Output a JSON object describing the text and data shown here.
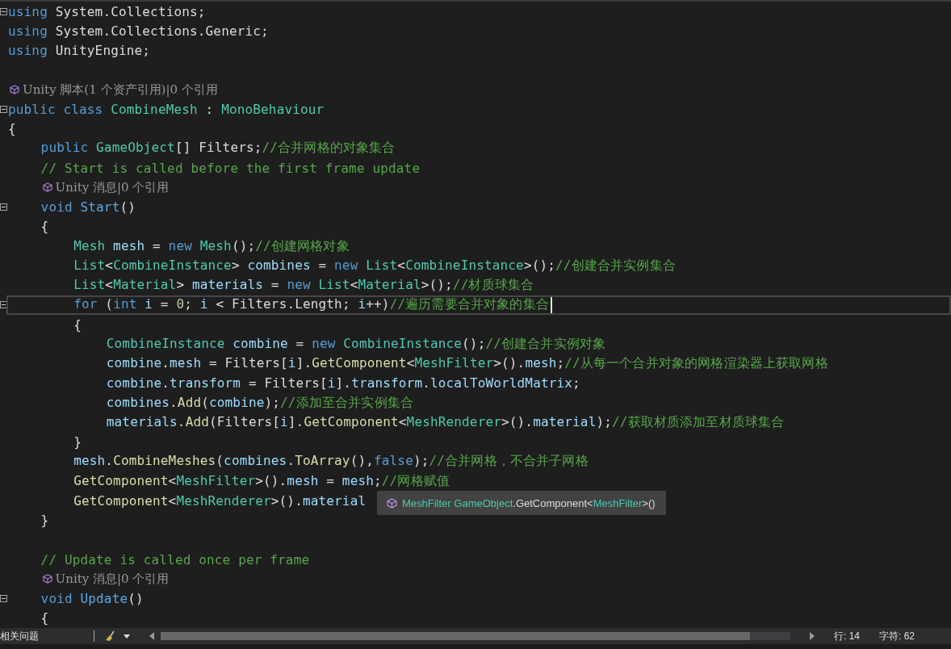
{
  "lines": [
    {
      "kind": "code",
      "fold": true,
      "current": false,
      "tokens": [
        {
          "t": "using",
          "color": "#569cd6"
        },
        {
          "t": " System.Collections;",
          "color": "#dcdcdc"
        }
      ]
    },
    {
      "kind": "code",
      "fold": false,
      "current": false,
      "tokens": [
        {
          "t": "using",
          "color": "#569cd6"
        },
        {
          "t": " System.Collections.Generic;",
          "color": "#dcdcdc"
        }
      ]
    },
    {
      "kind": "code",
      "fold": false,
      "current": false,
      "tokens": [
        {
          "t": "using",
          "color": "#569cd6"
        },
        {
          "t": " UnityEngine;",
          "color": "#dcdcdc"
        }
      ]
    },
    {
      "kind": "blank"
    },
    {
      "kind": "lens",
      "text": "Unity 脚本(1 个资产引用)|0 个引用"
    },
    {
      "kind": "code",
      "fold": true,
      "current": false,
      "tokens": [
        {
          "t": "public",
          "color": "#569cd6"
        },
        {
          "t": " class",
          "color": "#569cd6"
        },
        {
          "t": " CombineMesh",
          "color": "#4ec9b0"
        },
        {
          "t": " : ",
          "color": "#dcdcdc"
        },
        {
          "t": "MonoBehaviour",
          "color": "#4ec9b0"
        }
      ]
    },
    {
      "kind": "code",
      "fold": false,
      "current": false,
      "tokens": [
        {
          "t": "{",
          "color": "#dcdcdc"
        }
      ],
      "children": [
        {
          "kind": "code",
          "fold": false,
          "current": false,
          "tokens": [
            {
              "t": "public",
              "color": "#569cd6"
            },
            {
              "t": " GameObject",
              "color": "#4ec9b0"
            },
            {
              "t": "[] Filters;",
              "color": "#dcdcdc"
            },
            {
              "t": "//合并网格的对象集合",
              "color": "#57a64a"
            }
          ]
        },
        {
          "kind": "code",
          "fold": false,
          "current": false,
          "tokens": [
            {
              "t": "// Start is called before the first frame update",
              "color": "#57a64a"
            }
          ]
        },
        {
          "kind": "lens",
          "text": "Unity 消息|0 个引用"
        },
        {
          "kind": "code",
          "fold": true,
          "current": false,
          "tokens": [
            {
              "t": "void",
              "color": "#569cd6"
            },
            {
              "t": " Start",
              "color": "#5ca8e6"
            },
            {
              "t": "()",
              "color": "#dcdcdc"
            }
          ]
        },
        {
          "kind": "code",
          "fold": false,
          "current": false,
          "tokens": [
            {
              "t": "{",
              "color": "#dcdcdc"
            }
          ],
          "children": [
            {
              "kind": "code",
              "fold": false,
              "current": false,
              "tokens": [
                {
                  "t": "Mesh",
                  "color": "#4ec9b0"
                },
                {
                  "t": " mesh",
                  "color": "#9cdcfe"
                },
                {
                  "t": " = ",
                  "color": "#dcdcdc"
                },
                {
                  "t": "new",
                  "color": "#569cd6"
                },
                {
                  "t": " Mesh",
                  "color": "#4ec9b0"
                },
                {
                  "t": "();",
                  "color": "#dcdcdc"
                },
                {
                  "t": "//创建网格对象",
                  "color": "#57a64a"
                }
              ]
            },
            {
              "kind": "code",
              "fold": false,
              "current": false,
              "tokens": [
                {
                  "t": "List",
                  "color": "#4ec9b0"
                },
                {
                  "t": "<",
                  "color": "#dcdcdc"
                },
                {
                  "t": "CombineInstance",
                  "color": "#4ec9b0"
                },
                {
                  "t": ">",
                  "color": "#dcdcdc"
                },
                {
                  "t": " combines",
                  "color": "#9cdcfe"
                },
                {
                  "t": " = ",
                  "color": "#dcdcdc"
                },
                {
                  "t": "new",
                  "color": "#569cd6"
                },
                {
                  "t": " List",
                  "color": "#4ec9b0"
                },
                {
                  "t": "<",
                  "color": "#dcdcdc"
                },
                {
                  "t": "CombineInstance",
                  "color": "#4ec9b0"
                },
                {
                  "t": ">();",
                  "color": "#dcdcdc"
                },
                {
                  "t": "//创建合并实例集合",
                  "color": "#57a64a"
                }
              ]
            },
            {
              "kind": "code",
              "fold": false,
              "current": false,
              "tokens": [
                {
                  "t": "List",
                  "color": "#4ec9b0"
                },
                {
                  "t": "<",
                  "color": "#dcdcdc"
                },
                {
                  "t": "Material",
                  "color": "#4ec9b0"
                },
                {
                  "t": ">",
                  "color": "#dcdcdc"
                },
                {
                  "t": " materials",
                  "color": "#9cdcfe"
                },
                {
                  "t": " = ",
                  "color": "#dcdcdc"
                },
                {
                  "t": "new",
                  "color": "#569cd6"
                },
                {
                  "t": " List",
                  "color": "#4ec9b0"
                },
                {
                  "t": "<",
                  "color": "#dcdcdc"
                },
                {
                  "t": "Material",
                  "color": "#4ec9b0"
                },
                {
                  "t": ">();",
                  "color": "#dcdcdc"
                },
                {
                  "t": "//材质球集合",
                  "color": "#57a64a"
                }
              ]
            },
            {
              "kind": "code",
              "fold": true,
              "current": true,
              "tokens": [
                {
                  "t": "for",
                  "color": "#569cd6"
                },
                {
                  "t": " (",
                  "color": "#dcdcdc"
                },
                {
                  "t": "int",
                  "color": "#569cd6"
                },
                {
                  "t": " i",
                  "color": "#9cdcfe"
                },
                {
                  "t": " = ",
                  "color": "#dcdcdc"
                },
                {
                  "t": "0",
                  "color": "#b5cea8"
                },
                {
                  "t": "; ",
                  "color": "#dcdcdc"
                },
                {
                  "t": "i",
                  "color": "#9cdcfe"
                },
                {
                  "t": " < Filters.Length; ",
                  "color": "#dcdcdc"
                },
                {
                  "t": "i",
                  "color": "#9cdcfe"
                },
                {
                  "t": "++)",
                  "color": "#dcdcdc"
                },
                {
                  "t": "//遍历需要合并对象的集合",
                  "color": "#57a64a"
                }
              ]
            },
            {
              "kind": "code",
              "fold": false,
              "current": false,
              "tokens": [
                {
                  "t": "{",
                  "color": "#dcdcdc"
                }
              ],
              "children": [
                {
                  "kind": "code",
                  "fold": false,
                  "current": false,
                  "tokens": [
                    {
                      "t": "CombineInstance",
                      "color": "#4ec9b0"
                    },
                    {
                      "t": " combine",
                      "color": "#9cdcfe"
                    },
                    {
                      "t": " = ",
                      "color": "#dcdcdc"
                    },
                    {
                      "t": "new",
                      "color": "#569cd6"
                    },
                    {
                      "t": " CombineInstance",
                      "color": "#4ec9b0"
                    },
                    {
                      "t": "();",
                      "color": "#dcdcdc"
                    },
                    {
                      "t": "//创建合并实例对象",
                      "color": "#57a64a"
                    }
                  ]
                },
                {
                  "kind": "code",
                  "fold": false,
                  "current": false,
                  "tokens": [
                    {
                      "t": "combine",
                      "color": "#9cdcfe"
                    },
                    {
                      "t": ".",
                      "color": "#dcdcdc"
                    },
                    {
                      "t": "mesh",
                      "color": "#9cdcfe"
                    },
                    {
                      "t": " = Filters[",
                      "color": "#dcdcdc"
                    },
                    {
                      "t": "i",
                      "color": "#9cdcfe"
                    },
                    {
                      "t": "].",
                      "color": "#dcdcdc"
                    },
                    {
                      "t": "GetComponent",
                      "color": "#dcdcaa"
                    },
                    {
                      "t": "<",
                      "color": "#dcdcdc"
                    },
                    {
                      "t": "MeshFilter",
                      "color": "#4ec9b0"
                    },
                    {
                      "t": ">().",
                      "color": "#dcdcdc"
                    },
                    {
                      "t": "mesh",
                      "color": "#9cdcfe"
                    },
                    {
                      "t": ";",
                      "color": "#dcdcdc"
                    },
                    {
                      "t": "//从每一个合并对象的网格渲染器上获取网格",
                      "color": "#57a64a"
                    }
                  ]
                },
                {
                  "kind": "code",
                  "fold": false,
                  "current": false,
                  "tokens": [
                    {
                      "t": "combine",
                      "color": "#9cdcfe"
                    },
                    {
                      "t": ".",
                      "color": "#dcdcdc"
                    },
                    {
                      "t": "transform",
                      "color": "#9cdcfe"
                    },
                    {
                      "t": " = Filters[",
                      "color": "#dcdcdc"
                    },
                    {
                      "t": "i",
                      "color": "#9cdcfe"
                    },
                    {
                      "t": "].",
                      "color": "#dcdcdc"
                    },
                    {
                      "t": "transform",
                      "color": "#9cdcfe"
                    },
                    {
                      "t": ".",
                      "color": "#dcdcdc"
                    },
                    {
                      "t": "localToWorldMatrix",
                      "color": "#9cdcfe"
                    },
                    {
                      "t": ";",
                      "color": "#dcdcdc"
                    }
                  ]
                },
                {
                  "kind": "code",
                  "fold": false,
                  "current": false,
                  "tokens": [
                    {
                      "t": "combines",
                      "color": "#9cdcfe"
                    },
                    {
                      "t": ".Add",
                      "color": "#dcdcaa"
                    },
                    {
                      "t": "(",
                      "color": "#dcdcdc"
                    },
                    {
                      "t": "combine",
                      "color": "#9cdcfe"
                    },
                    {
                      "t": ");",
                      "color": "#dcdcdc"
                    },
                    {
                      "t": "//添加至合并实例集合",
                      "color": "#57a64a"
                    }
                  ]
                },
                {
                  "kind": "code",
                  "fold": false,
                  "current": false,
                  "tokens": [
                    {
                      "t": "materials",
                      "color": "#9cdcfe"
                    },
                    {
                      "t": ".Add",
                      "color": "#dcdcaa"
                    },
                    {
                      "t": "(Filters[",
                      "color": "#dcdcdc"
                    },
                    {
                      "t": "i",
                      "color": "#9cdcfe"
                    },
                    {
                      "t": "].",
                      "color": "#dcdcdc"
                    },
                    {
                      "t": "GetComponent",
                      "color": "#dcdcaa"
                    },
                    {
                      "t": "<",
                      "color": "#dcdcdc"
                    },
                    {
                      "t": "MeshRenderer",
                      "color": "#4ec9b0"
                    },
                    {
                      "t": ">().",
                      "color": "#dcdcdc"
                    },
                    {
                      "t": "material",
                      "color": "#9cdcfe"
                    },
                    {
                      "t": ");",
                      "color": "#dcdcdc"
                    },
                    {
                      "t": "//获取材质添加至材质球集合",
                      "color": "#57a64a"
                    }
                  ]
                }
              ]
            },
            {
              "kind": "code",
              "fold": false,
              "current": false,
              "tokens": [
                {
                  "t": "}",
                  "color": "#dcdcdc"
                }
              ]
            },
            {
              "kind": "code",
              "fold": false,
              "current": false,
              "tokens": [
                {
                  "t": "mesh",
                  "color": "#9cdcfe"
                },
                {
                  "t": ".",
                  "color": "#dcdcdc"
                },
                {
                  "t": "CombineMeshes",
                  "color": "#dcdcaa"
                },
                {
                  "t": "(",
                  "color": "#dcdcdc"
                },
                {
                  "t": "combines",
                  "color": "#9cdcfe"
                },
                {
                  "t": ".ToArray",
                  "color": "#dcdcaa"
                },
                {
                  "t": "(),",
                  "color": "#dcdcdc"
                },
                {
                  "t": "false",
                  "color": "#569cd6"
                },
                {
                  "t": ");",
                  "color": "#dcdcdc"
                },
                {
                  "t": "//合并网格，不合并子网格",
                  "color": "#57a64a"
                }
              ]
            },
            {
              "kind": "code",
              "fold": false,
              "current": false,
              "tokens": [
                {
                  "t": "GetComponent",
                  "color": "#dcdcaa"
                },
                {
                  "t": "<",
                  "color": "#dcdcdc"
                },
                {
                  "t": "MeshFilter",
                  "color": "#4ec9b0"
                },
                {
                  "t": ">().",
                  "color": "#dcdcdc"
                },
                {
                  "t": "mesh",
                  "color": "#9cdcfe"
                },
                {
                  "t": " = ",
                  "color": "#dcdcdc"
                },
                {
                  "t": "mesh",
                  "color": "#9cdcfe"
                },
                {
                  "t": ";",
                  "color": "#dcdcdc"
                },
                {
                  "t": "//网格赋值",
                  "color": "#57a64a"
                }
              ]
            },
            {
              "kind": "code",
              "fold": false,
              "current": false,
              "tokens": [
                {
                  "t": "GetComponent",
                  "color": "#dcdcaa"
                },
                {
                  "t": "<",
                  "color": "#dcdcdc"
                },
                {
                  "t": "MeshRenderer",
                  "color": "#4ec9b0"
                },
                {
                  "t": ">().",
                  "color": "#dcdcdc"
                },
                {
                  "t": "material",
                  "color": "#9cdcfe"
                }
              ]
            }
          ]
        },
        {
          "kind": "code",
          "fold": false,
          "current": false,
          "tokens": [
            {
              "t": "}",
              "color": "#dcdcdc"
            }
          ]
        },
        {
          "kind": "blank"
        },
        {
          "kind": "code",
          "fold": false,
          "current": false,
          "tokens": [
            {
              "t": "// Update is called once per frame",
              "color": "#57a64a"
            }
          ]
        },
        {
          "kind": "lens",
          "text": "Unity 消息|0 个引用"
        },
        {
          "kind": "code",
          "fold": true,
          "current": false,
          "tokens": [
            {
              "t": "void",
              "color": "#569cd6"
            },
            {
              "t": " Update",
              "color": "#5ca8e6"
            },
            {
              "t": "()",
              "color": "#dcdcdc"
            }
          ]
        },
        {
          "kind": "code",
          "fold": false,
          "current": false,
          "tokens": [
            {
              "t": "{",
              "color": "#dcdcdc"
            }
          ]
        }
      ]
    }
  ],
  "tooltip": {
    "tokens": [
      {
        "t": "MeshFilter",
        "color": "#4ec9b0"
      },
      {
        "t": " GameObject",
        "color": "#4ec9b0"
      },
      {
        "t": ".GetComponent<",
        "color": "#dcdcdc"
      },
      {
        "t": "MeshFilter",
        "color": "#4ec9b0"
      },
      {
        "t": ">()",
        "color": "#dcdcdc"
      }
    ]
  },
  "status_bar": {
    "issues": "相关问题",
    "line": "行: 14",
    "column": "字符: 62"
  }
}
